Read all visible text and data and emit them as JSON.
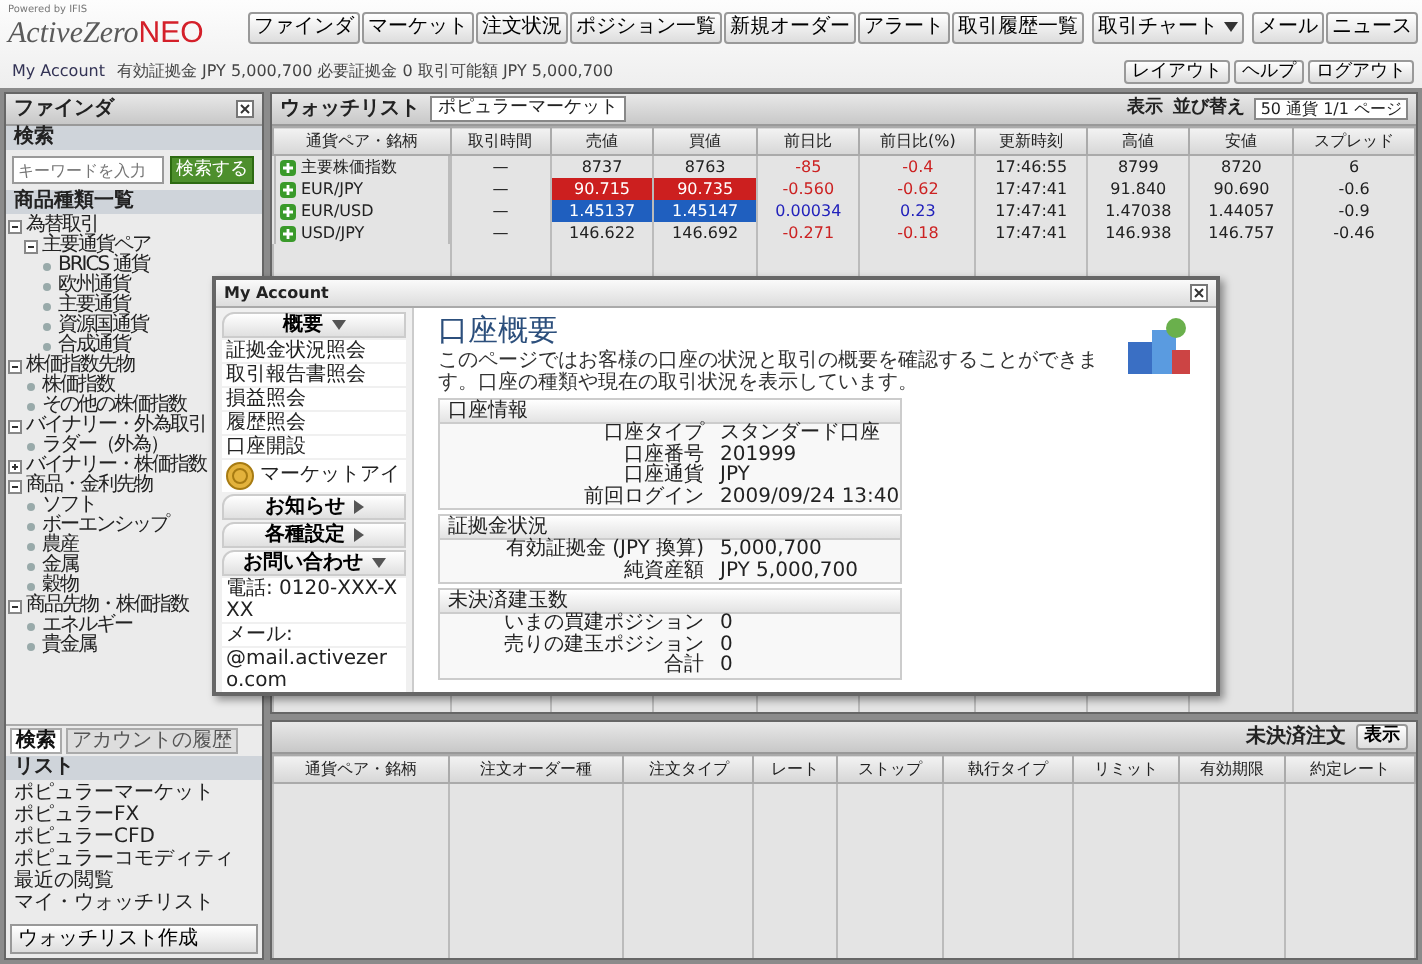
{
  "header": {
    "tagline": "Powered by IFIS",
    "logo": "ActiveZero",
    "logo_suffix": "NEO",
    "nav": [
      "ファインダ",
      "マーケット",
      "注文状況",
      "ポジション一覧",
      "新規オーダー",
      "アラート",
      "取引履歴一覧"
    ],
    "menu_button": "取引チャート",
    "links": [
      "メール",
      "ニュース"
    ],
    "account_link": "My Account",
    "account_summary": "有効証拠金 JPY 5,000,700  必要証拠金 0  取引可能額 JPY 5,000,700",
    "utility": [
      "レイアウト",
      "ヘルプ",
      "ログアウト"
    ]
  },
  "finder": {
    "title": "ファインダ",
    "search_label": "検索",
    "search": {
      "placeholder": "キーワードを入力"
    },
    "search_button": "検索する",
    "tree_title": "商品種類一覧",
    "tree": [
      {
        "label": "為替取引",
        "expanded": true,
        "children": [
          {
            "label": "主要通貨ペア",
            "expanded": true,
            "children": [
              {
                "label": "BRICS 通貨"
              },
              {
                "label": "欧州通貨"
              },
              {
                "label": "主要通貨"
              },
              {
                "label": "資源国通貨"
              },
              {
                "label": "合成通貨"
              }
            ]
          }
        ]
      },
      {
        "label": "株価指数先物",
        "expanded": true,
        "children": [
          {
            "label": "株価指数"
          },
          {
            "label": "その他の株価指数"
          }
        ]
      },
      {
        "label": "バイナリー・外為取引",
        "expanded": true,
        "children": [
          {
            "label": "ラダー（外為）"
          }
        ]
      },
      {
        "label": "バイナリー・株価指数",
        "expanded": false
      },
      {
        "label": "商品・金利先物",
        "expanded": true,
        "children": [
          {
            "label": "ソフト"
          },
          {
            "label": "ボーエンシップ"
          },
          {
            "label": "農産"
          },
          {
            "label": "金属"
          },
          {
            "label": "穀物"
          }
        ]
      },
      {
        "label": "商品先物・株価指数",
        "expanded": true,
        "children": [
          {
            "label": "エネルギー"
          },
          {
            "label": "貴金属"
          }
        ]
      }
    ],
    "tabs": [
      {
        "label": "検索",
        "selected": true
      },
      {
        "label": "アカウントの履歴",
        "selected": false
      }
    ],
    "list_title": "リスト",
    "lists": [
      "ポピュラーマーケット",
      "ポピュラーFX",
      "ポピュラーCFD",
      "ポピュラーコモディティ",
      "最近の閲覧",
      "マイ・ウォッチリスト"
    ],
    "create_button": "ウォッチリスト作成"
  },
  "watchlist": {
    "title": "ウォッチリスト",
    "dropdown": "ポピュラーマーケット",
    "view_label": "表示",
    "sort_label": "並び替え",
    "page_select": "50 通貨 1/1 ページ",
    "columns": [
      "通貨ペア・銘柄",
      "取引時間",
      "売値",
      "買値",
      "前日比",
      "前日比(%)",
      "更新時刻",
      "高値",
      "安値",
      "スプレッド"
    ],
    "rows": [
      {
        "name": "主要株価指数",
        "hours": "—",
        "sell": "8737",
        "buy": "8763",
        "change": "-85",
        "pct": "-0.4",
        "time": "17:46:55",
        "high": "8799",
        "low": "8720",
        "spread": "6",
        "tick_up": false,
        "tick_down": false,
        "negative": true
      },
      {
        "name": "EUR/JPY",
        "hours": "—",
        "sell": "90.715",
        "buy": "90.735",
        "change": "-0.560",
        "pct": "-0.62",
        "time": "17:47:41",
        "high": "91.840",
        "low": "90.690",
        "spread": "-0.6",
        "tick_up": false,
        "tick_down": true,
        "negative": true
      },
      {
        "name": "EUR/USD",
        "hours": "—",
        "sell": "1.45137",
        "buy": "1.45147",
        "change": "0.00034",
        "pct": "0.23",
        "time": "17:47:41",
        "high": "1.47038",
        "low": "1.44057",
        "spread": "-0.9",
        "tick_up": true,
        "tick_down": false,
        "negative": false
      },
      {
        "name": "USD/JPY",
        "hours": "—",
        "sell": "146.622",
        "buy": "146.692",
        "change": "-0.271",
        "pct": "-0.18",
        "time": "17:47:41",
        "high": "146.938",
        "low": "146.757",
        "spread": "-0.46",
        "tick_up": false,
        "tick_down": false,
        "negative": true
      }
    ]
  },
  "orders": {
    "title": "未決済注文",
    "view_button": "表示",
    "columns": [
      "通貨ペア・銘柄",
      "注文オーダー種",
      "注文タイプ",
      "レート",
      "ストップ",
      "執行タイプ",
      "リミット",
      "有効期限",
      "約定レート"
    ]
  },
  "account": {
    "title": "My Account",
    "nav": [
      {
        "kind": "header",
        "label": "概要",
        "expanded": true
      },
      {
        "kind": "link",
        "label": "証拠金状況照会"
      },
      {
        "kind": "link",
        "label": "取引報告書照会"
      },
      {
        "kind": "link",
        "label": "損益照会"
      },
      {
        "kind": "link",
        "label": "履歴照会"
      },
      {
        "kind": "link",
        "label": "口座開設"
      },
      {
        "kind": "icon",
        "label": "マーケットアイ"
      },
      {
        "kind": "header",
        "label": "お知らせ",
        "expanded": false
      },
      {
        "kind": "header",
        "label": "各種設定",
        "expanded": false
      },
      {
        "kind": "header",
        "label": "お問い合わせ",
        "expanded": true
      },
      {
        "kind": "text",
        "label": "電話: 0120-XXX-XXX"
      },
      {
        "kind": "text",
        "label": "メール:"
      },
      {
        "kind": "text",
        "label": "@mail.activezero.com"
      }
    ],
    "heading": "口座概要",
    "intro": "このページではお客様の口座の状況と取引の概要を確認することができます。口座の種類や現在の取引状況を表示しています。",
    "sections": [
      {
        "title": "口座情報",
        "rows": [
          [
            "口座タイプ",
            "スタンダード口座"
          ],
          [
            "口座番号",
            "201999"
          ],
          [
            "口座通貨",
            "JPY"
          ],
          [
            "前回ログイン",
            "2009/09/24 13:40"
          ]
        ]
      },
      {
        "title": "証拠金状況",
        "rows": [
          [
            "有効証拠金 (JPY 換算)",
            "5,000,700"
          ],
          [
            "純資産額",
            "JPY 5,000,700"
          ]
        ]
      },
      {
        "title": "未決済建玉数",
        "rows": [
          [
            "いまの買建ポジション",
            "0"
          ],
          [
            "売りの建玉ポジション",
            "0"
          ],
          [
            "合計",
            "0"
          ]
        ]
      }
    ]
  }
}
